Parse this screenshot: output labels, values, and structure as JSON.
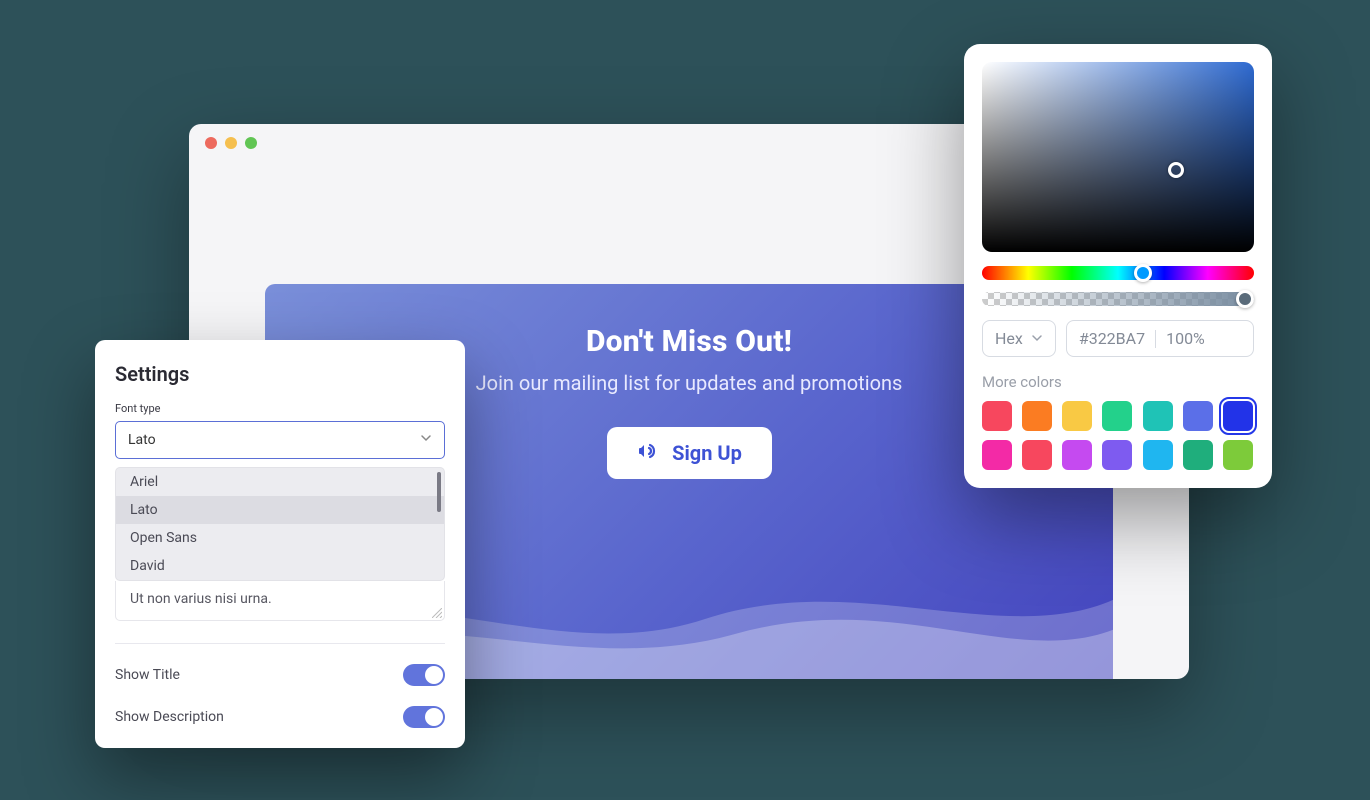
{
  "hero": {
    "title": "Don't Miss Out!",
    "subtitle": "Join our mailing list for updates and promotions",
    "button_label": "Sign Up"
  },
  "settings": {
    "title": "Settings",
    "font_type_label": "Font type",
    "font_selected": "Lato",
    "font_options": [
      "Ariel",
      "Lato",
      "Open Sans",
      "David"
    ],
    "textarea_value": "Ut non varius nisi urna.",
    "toggles": [
      {
        "label": "Show Title",
        "on": true
      },
      {
        "label": "Show Description",
        "on": true
      }
    ]
  },
  "picker": {
    "format_label": "Hex",
    "hex_value": "#322BA7",
    "opacity_value": "100%",
    "more_label": "More colors",
    "swatches_row1": [
      "#f7475e",
      "#fb7c22",
      "#f9c944",
      "#23d18b",
      "#1fc3b6",
      "#5b6fe8",
      "#2233e8"
    ],
    "swatches_row2": [
      "#f32aa6",
      "#f7475e",
      "#c54af0",
      "#7e5bf0",
      "#1fb6f0",
      "#1fae7c",
      "#7dcb3a"
    ],
    "active_swatch_index": 6
  }
}
